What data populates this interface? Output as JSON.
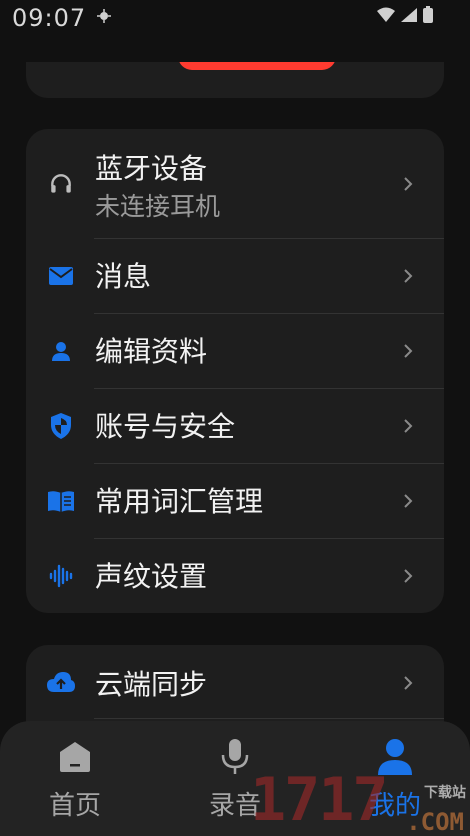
{
  "status_bar": {
    "time": "09:07"
  },
  "colors": {
    "accent": "#1a73e8",
    "danger": "#ff3b30",
    "card_bg": "#1e1e1e",
    "page_bg": "#111111"
  },
  "menu": {
    "items": [
      {
        "title": "蓝牙设备",
        "subtitle": "未连接耳机",
        "icon": "headphones-icon"
      },
      {
        "title": "消息",
        "icon": "mail-icon"
      },
      {
        "title": "编辑资料",
        "icon": "person-icon"
      },
      {
        "title": "账号与安全",
        "icon": "shield-icon"
      },
      {
        "title": "常用词汇管理",
        "icon": "book-icon"
      },
      {
        "title": "声纹设置",
        "icon": "voiceprint-icon"
      }
    ]
  },
  "cloud": {
    "title": "云端同步",
    "icon": "cloud-upload-icon"
  },
  "nav": {
    "items": [
      {
        "label": "首页",
        "icon": "home-icon",
        "active": false
      },
      {
        "label": "录音",
        "icon": "microphone-icon",
        "active": false
      },
      {
        "label": "我的",
        "icon": "profile-icon",
        "active": true
      }
    ]
  },
  "watermark": {
    "brand": "1717",
    "cn": "下载站",
    "domain": ".COM"
  }
}
